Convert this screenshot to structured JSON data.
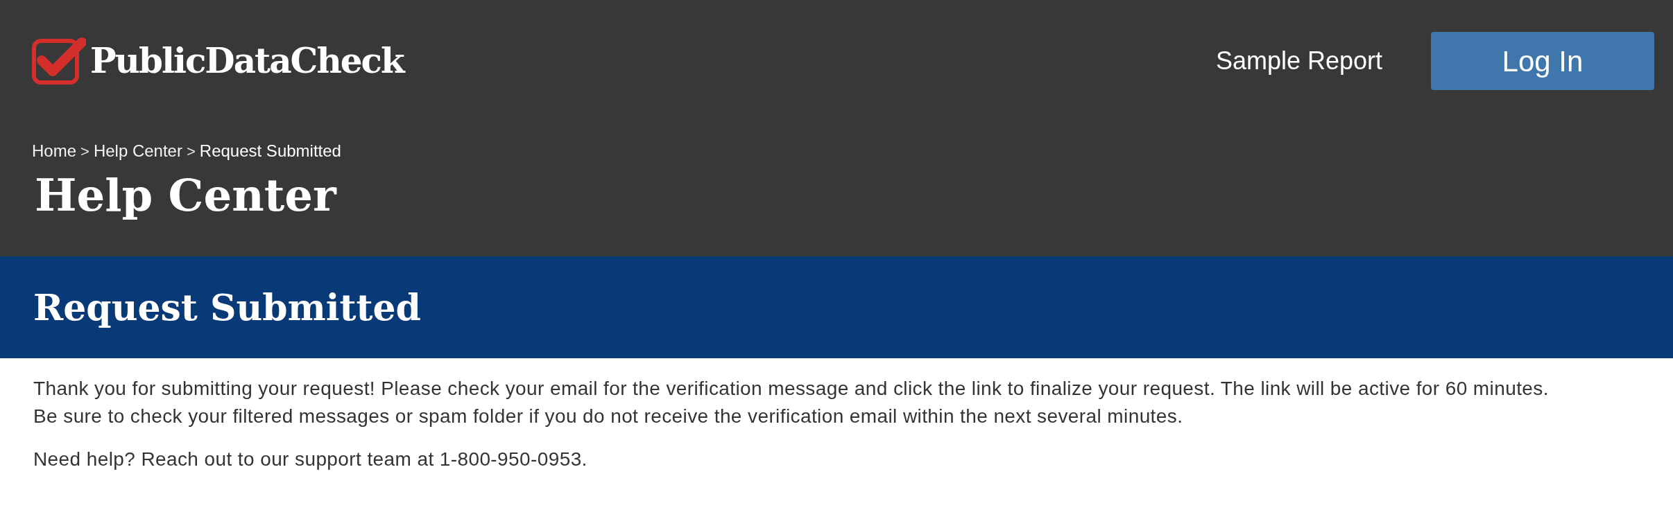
{
  "header": {
    "logo_text": "PublicDataCheck",
    "nav": [
      {
        "label": "Sample Report",
        "kind": "link"
      },
      {
        "label": "Log In",
        "kind": "button"
      }
    ]
  },
  "breadcrumb": [
    {
      "kind": "link",
      "text": "Home"
    },
    {
      "kind": "separator",
      "text": ">"
    },
    {
      "kind": "link",
      "text": "Help Center"
    },
    {
      "kind": "separator",
      "text": ">"
    },
    {
      "kind": "current",
      "text": "Request Submitted"
    }
  ],
  "page_title": "Help Center",
  "section_title": "Request Submitted",
  "paragraphs": [
    "Thank you for submitting your request! Please check your email for the verification message and click the link to finalize your request. The link will be active for 60 minutes. Be sure to check your filtered messages or spam folder if you do not receive the verification email within the next several minutes.",
    "Need help? Reach out to our support team at 1-800-950-0953."
  ]
}
